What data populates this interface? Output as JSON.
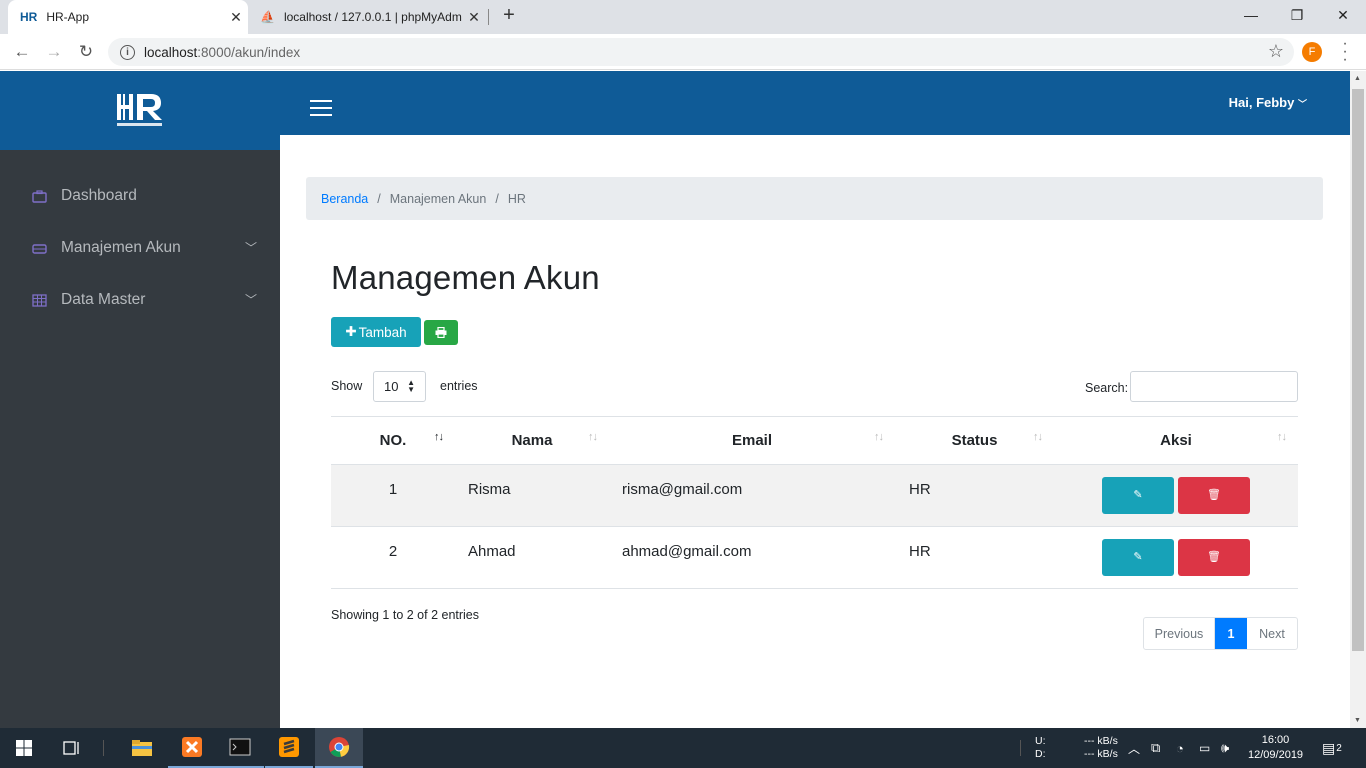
{
  "browser": {
    "tabs": [
      {
        "title": "HR-App",
        "favicon": "HR"
      },
      {
        "title": "localhost / 127.0.0.1 | phpMyAdmin"
      }
    ],
    "url_host": "localhost",
    "url_path": ":8000/akun/index",
    "profile_initial": "F"
  },
  "header": {
    "logo": "HR",
    "user_greeting": "Hai, Febby"
  },
  "sidebar": {
    "items": [
      {
        "label": "Dashboard",
        "icon": "briefcase-icon"
      },
      {
        "label": "Manajemen Akun",
        "icon": "card-icon"
      },
      {
        "label": "Data Master",
        "icon": "table-icon"
      }
    ]
  },
  "breadcrumb": {
    "home": "Beranda",
    "section": "Manajemen Akun",
    "current": "HR"
  },
  "page": {
    "title": "Managemen Akun",
    "add_button": "Tambah"
  },
  "table_controls": {
    "show_label": "Show",
    "length_value": "10",
    "entries_label": "entries",
    "search_label": "Search:",
    "info": "Showing 1 to 2 of 2 entries"
  },
  "table": {
    "headers": [
      "NO.",
      "Nama",
      "Email",
      "Status",
      "Aksi"
    ],
    "rows": [
      {
        "no": "1",
        "nama": "Risma",
        "email": "risma@gmail.com",
        "status": "HR"
      },
      {
        "no": "2",
        "nama": "Ahmad",
        "email": "ahmad@gmail.com",
        "status": "HR"
      }
    ]
  },
  "pagination": {
    "previous": "Previous",
    "current": "1",
    "next": "Next"
  },
  "taskbar": {
    "net_up_label": "U:",
    "net_down_label": "D:",
    "net_up_value": "--- kB/s",
    "net_down_value": "--- kB/s",
    "time": "16:00",
    "date": "12/09/2019",
    "notifications": "2"
  },
  "colors": {
    "primary_blue": "#0f5b97",
    "sidebar_bg": "#343a40",
    "info": "#17a2b8",
    "success": "#28a745",
    "danger": "#dc3545",
    "link": "#007bff"
  }
}
